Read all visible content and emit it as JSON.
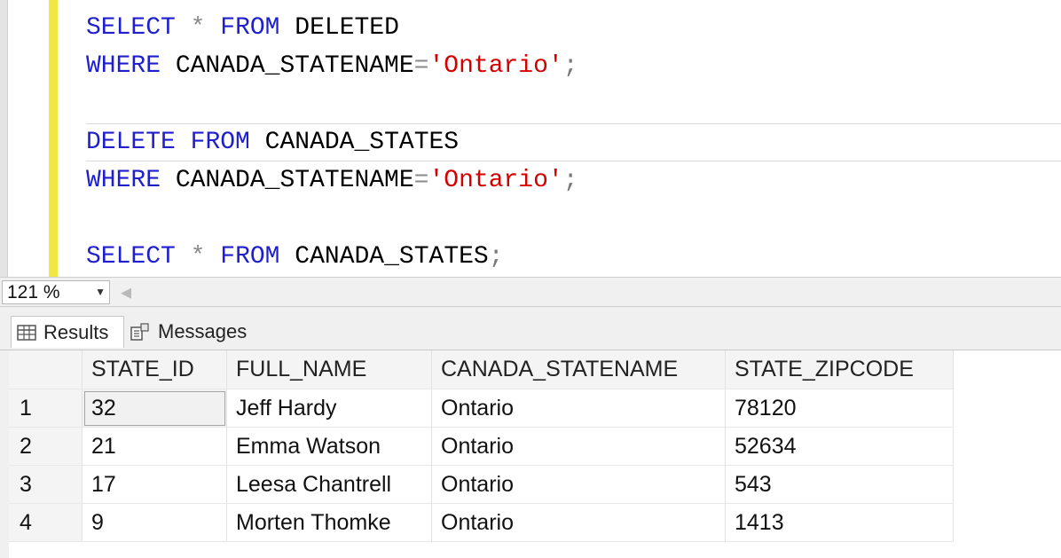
{
  "editor": {
    "lines": [
      [
        {
          "t": "SELECT",
          "c": "kw"
        },
        {
          "t": " ",
          "c": ""
        },
        {
          "t": "*",
          "c": "op"
        },
        {
          "t": " ",
          "c": ""
        },
        {
          "t": "FROM",
          "c": "kw"
        },
        {
          "t": " DELETED",
          "c": ""
        }
      ],
      [
        {
          "t": "WHERE",
          "c": "kw"
        },
        {
          "t": " CANADA_STATENAME",
          "c": ""
        },
        {
          "t": "=",
          "c": "op"
        },
        {
          "t": "'Ontario'",
          "c": "str"
        },
        {
          "t": ";",
          "c": "punc"
        }
      ],
      [],
      [
        {
          "t": "DELETE",
          "c": "kw"
        },
        {
          "t": " ",
          "c": ""
        },
        {
          "t": "FROM",
          "c": "kw"
        },
        {
          "t": " CANADA_STATES",
          "c": ""
        }
      ],
      [
        {
          "t": "WHERE",
          "c": "kw"
        },
        {
          "t": " CANADA_STATENAME",
          "c": ""
        },
        {
          "t": "=",
          "c": "op"
        },
        {
          "t": "'Ontario'",
          "c": "str"
        },
        {
          "t": ";",
          "c": "punc"
        }
      ],
      [],
      [
        {
          "t": "SELECT",
          "c": "kw"
        },
        {
          "t": " ",
          "c": ""
        },
        {
          "t": "*",
          "c": "op"
        },
        {
          "t": " ",
          "c": ""
        },
        {
          "t": "FROM",
          "c": "kw"
        },
        {
          "t": " CANADA_STATES",
          "c": ""
        },
        {
          "t": ";",
          "c": "punc"
        }
      ]
    ],
    "current_line": 3
  },
  "zoom": {
    "value": "121 %"
  },
  "tabs": {
    "results_label": "Results",
    "messages_label": "Messages"
  },
  "grid": {
    "columns": [
      "STATE_ID",
      "FULL_NAME",
      "CANADA_STATENAME",
      "STATE_ZIPCODE"
    ],
    "rows": [
      {
        "num": "1",
        "cells": [
          "32",
          "Jeff Hardy",
          "Ontario",
          "78120"
        ]
      },
      {
        "num": "2",
        "cells": [
          "21",
          "Emma Watson",
          "Ontario",
          "52634"
        ]
      },
      {
        "num": "3",
        "cells": [
          "17",
          "Leesa Chantrell",
          "Ontario",
          "543"
        ]
      },
      {
        "num": "4",
        "cells": [
          "9",
          "Morten Thomke",
          "Ontario",
          "1413"
        ]
      }
    ]
  },
  "colors": {
    "keyword": "#1f1fcc",
    "string": "#d40000",
    "change_bar": "#f2e640"
  }
}
